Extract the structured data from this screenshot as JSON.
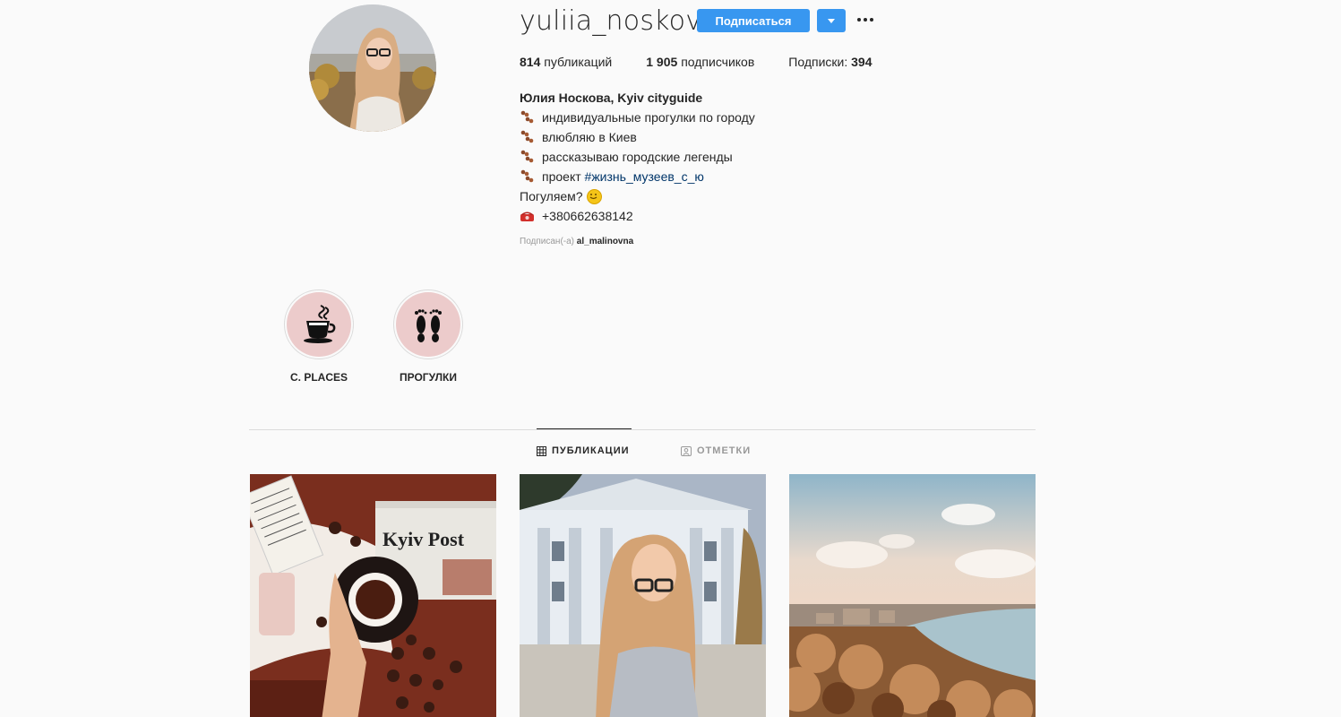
{
  "profile": {
    "username": "yuliia_noskova",
    "follow_label": "Подписаться",
    "stats": {
      "posts_count": "814",
      "posts_label": "публикаций",
      "followers_count": "1 905",
      "followers_label": "подписчиков",
      "following_label": "Подписки:",
      "following_count": "394"
    },
    "bio": {
      "name": "Юлия Носкова, Kyiv cityguide",
      "lines": [
        "индивидуальные прогулки по городу",
        "влюбляю в Киев",
        "рассказываю городские легенды"
      ],
      "project_prefix": "проект ",
      "project_hashtag": "#жизнь_музеев_с_ю",
      "walk_question": "Погуляем?",
      "phone": "+380662638142"
    },
    "followed_by_label": "Подписан(-а)",
    "followed_by_user": "al_malinovna"
  },
  "highlights": [
    {
      "label": "C. PLACES",
      "icon": "coffee-cup-icon"
    },
    {
      "label": "ПРОГУЛКИ",
      "icon": "footprints-icon"
    }
  ],
  "tabs": [
    {
      "label": "ПУБЛИКАЦИИ",
      "icon": "grid-icon",
      "active": true
    },
    {
      "label": "ОТМЕТКИ",
      "icon": "tag-user-icon",
      "active": false
    }
  ],
  "posts": [
    {
      "kind": "coffee-flatlay",
      "newspaper_text": "Kyiv Post"
    },
    {
      "kind": "portrait-building"
    },
    {
      "kind": "city-river-view"
    }
  ],
  "colors": {
    "accent": "#3897f0",
    "highlight_bg": "#eccbcb",
    "hashtag": "#003569"
  }
}
